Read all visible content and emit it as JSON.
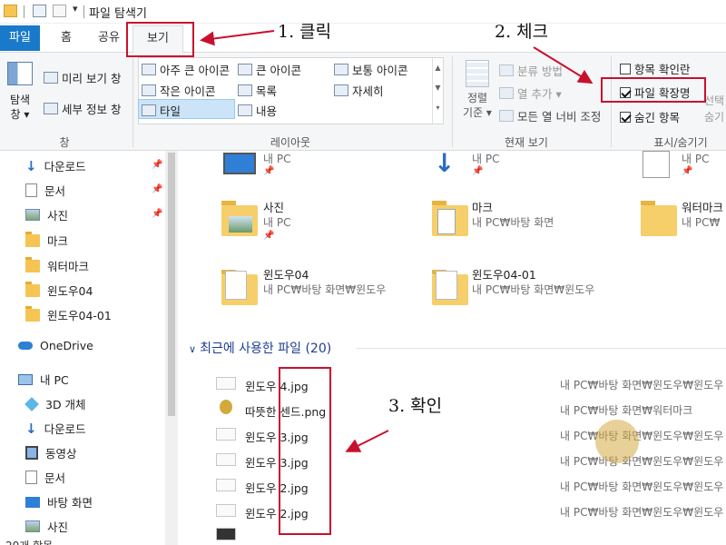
{
  "window": {
    "title": "파일 탐색기"
  },
  "ribbon_tabs": [
    "파일",
    "홈",
    "공유",
    "보기"
  ],
  "ribbon": {
    "panes": {
      "nav_pane_label": "탐색\n창 ▾",
      "preview_pane": "미리 보기 창",
      "details_pane": "세부 정보 창",
      "group_label": "창"
    },
    "layout": {
      "items": [
        "아주 큰 아이콘",
        "큰 아이콘",
        "보통 아이콘",
        "작은 아이콘",
        "목록",
        "자세히",
        "타일",
        "내용"
      ],
      "group_label": "레이아웃"
    },
    "current_view": {
      "sort_label": "정렬\n기준 ▾",
      "group_by": "분류 방법",
      "add_column": "열 추가 ▾",
      "fit_columns": "모든 열 너비 조정",
      "group_label": "현재 보기"
    },
    "show_hide": {
      "item_checkbox": "항목 확인란",
      "file_extensions": "파일 확장명",
      "hidden_items": "숨긴 항목",
      "selected_hide": "선택\n숨기",
      "group_label": "표시/숨기기"
    }
  },
  "nav_pane": {
    "quick_items": [
      "다운로드",
      "문서",
      "사진",
      "마크",
      "워터마크",
      "윈도우04",
      "윈도우04-01"
    ],
    "onedrive": "OneDrive",
    "this_pc": "내 PC",
    "pc_items": [
      "3D 개체",
      "다운로드",
      "동영상",
      "문서",
      "바탕 화면",
      "사진"
    ],
    "status": "20개 항목"
  },
  "content": {
    "top_partial": [
      {
        "sub": "내 PC"
      },
      {
        "sub": "내 PC"
      },
      {
        "sub": "내 PC"
      }
    ],
    "folders": [
      {
        "name": "사진",
        "sub": "내 PC"
      },
      {
        "name": "마크",
        "sub": "내 PC₩바탕 화면"
      },
      {
        "name": "워터마크",
        "sub": "내 PC₩"
      },
      {
        "name": "윈도우04",
        "sub": "내 PC₩바탕 화면₩윈도우"
      },
      {
        "name": "윈도우04-01",
        "sub": "내 PC₩바탕 화면₩윈도우"
      }
    ],
    "recent_header": "최근에 사용한 파일 (20)",
    "recent_files": [
      {
        "name": "윈도우 4.jpg",
        "path": "내 PC₩바탕 화면₩윈도우₩윈도우"
      },
      {
        "name": "따뜻한 센드.png",
        "path": "내 PC₩바탕 화면₩워터마크"
      },
      {
        "name": "윈도우 3.jpg",
        "path": "내 PC₩바탕 화면₩윈도우₩윈도우"
      },
      {
        "name": "윈도우 3.jpg",
        "path": "내 PC₩바탕 화면₩윈도우₩윈도우"
      },
      {
        "name": "윈도우 2.jpg",
        "path": "내 PC₩바탕 화면₩윈도우₩윈도우"
      },
      {
        "name": "윈도우 2.jpg",
        "path": "내 PC₩바탕 화면₩윈도우₩윈도우"
      }
    ]
  },
  "annotations": {
    "step1": "1. 클릭",
    "step2": "2. 체크",
    "step3": "3. 확인",
    "color": "#c8102e"
  },
  "colors": {
    "file_tab": "#1979ca",
    "ribbon_bg": "#f5f6f7",
    "section_header": "#1e3d8f"
  }
}
